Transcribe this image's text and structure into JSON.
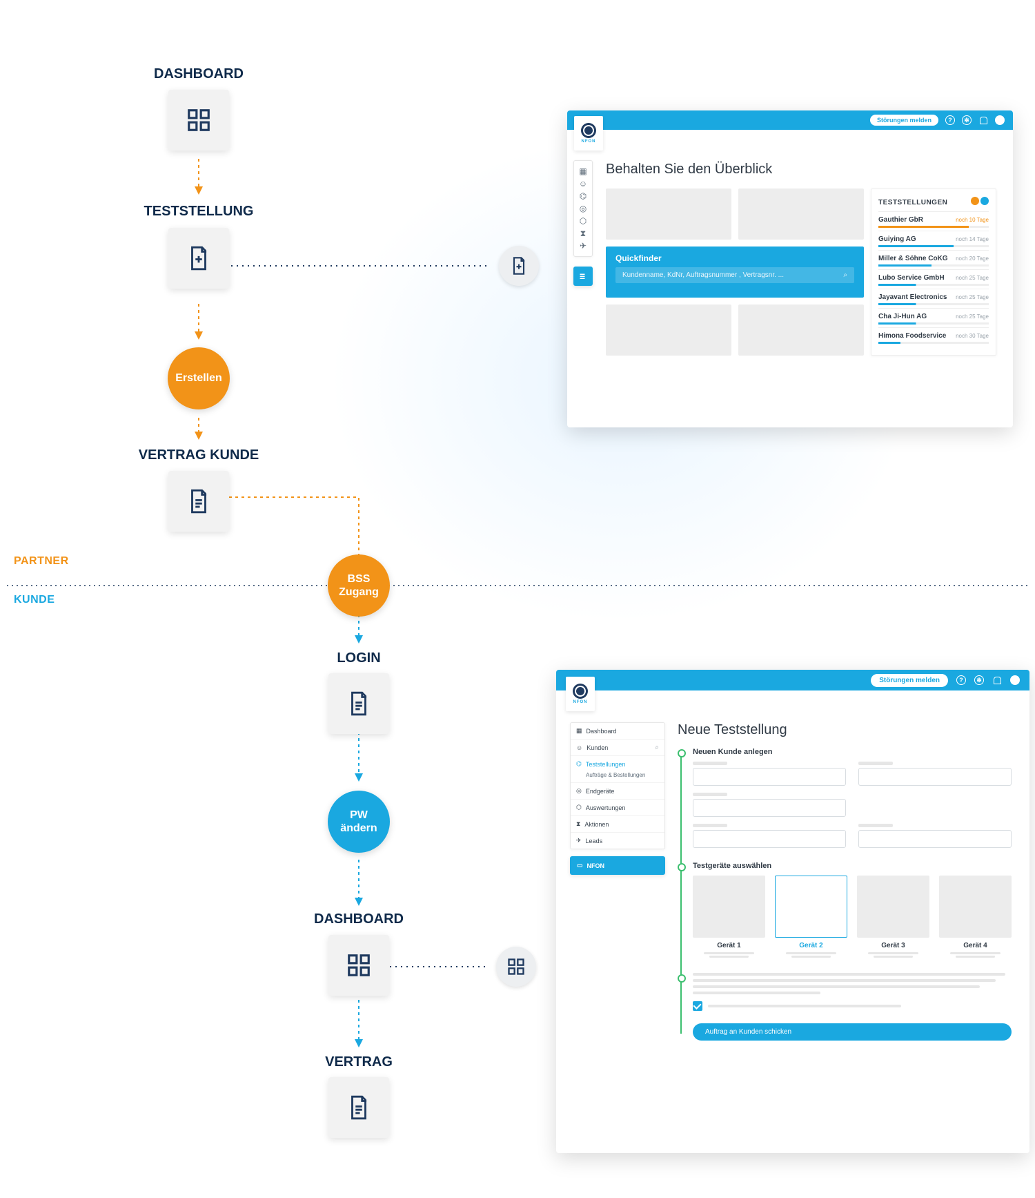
{
  "flow": {
    "dashboard": "DASHBOARD",
    "teststellung": "TESTSTELLUNG",
    "erstellen": "Erstellen",
    "vertrag_kunde": "VERTRAG KUNDE",
    "bss_zugang": "BSS\nZugang",
    "login": "LOGIN",
    "pw_aendern": "PW\nändern",
    "dashboard2": "DASHBOARD",
    "vertrag": "VERTRAG"
  },
  "sections": {
    "partner": "PARTNER",
    "kunde": "KUNDE"
  },
  "shot1": {
    "header_button": "Störungen melden",
    "logo_text": "NFON",
    "title": "Behalten Sie den Überblick",
    "quickfinder": {
      "title": "Quickfinder",
      "placeholder": "Kundenname, KdNr, Auftragsnummer , Vertragsnr. ..."
    },
    "list": {
      "title": "TESTSTELLUNGEN",
      "items": [
        {
          "name": "Gauthier GbR",
          "meta": "noch 10 Tage",
          "pct": 82,
          "warn": true
        },
        {
          "name": "Guiying AG",
          "meta": "noch 14 Tage",
          "pct": 68,
          "warn": false
        },
        {
          "name": "Miller & Söhne CoKG",
          "meta": "noch 20 Tage",
          "pct": 48,
          "warn": false
        },
        {
          "name": "Lubo Service GmbH",
          "meta": "noch 25 Tage",
          "pct": 34,
          "warn": false
        },
        {
          "name": "Jayavant Electronics",
          "meta": "noch 25 Tage",
          "pct": 34,
          "warn": false
        },
        {
          "name": "Cha Ji-Hun AG",
          "meta": "noch 25 Tage",
          "pct": 34,
          "warn": false
        },
        {
          "name": "Himona Foodservice",
          "meta": "noch 30 Tage",
          "pct": 20,
          "warn": false
        }
      ]
    }
  },
  "shot2": {
    "header_button": "Störungen melden",
    "logo_text": "NFON",
    "menu": {
      "dashboard": "Dashboard",
      "kunden": "Kunden",
      "teststellungen": "Teststellungen",
      "sub": "Aufträge & Bestellungen",
      "endgeraete": "Endgeräte",
      "auswertungen": "Auswertungen",
      "aktionen": "Aktionen",
      "leads": "Leads",
      "nfon_btn": "NFON"
    },
    "title": "Neue Teststellung",
    "step1": "Neuen Kunde anlegen",
    "step2": "Testgeräte auswählen",
    "devices": [
      "Gerät 1",
      "Gerät 2",
      "Gerät 3",
      "Gerät 4"
    ],
    "submit": "Auftrag an Kunden schicken"
  }
}
